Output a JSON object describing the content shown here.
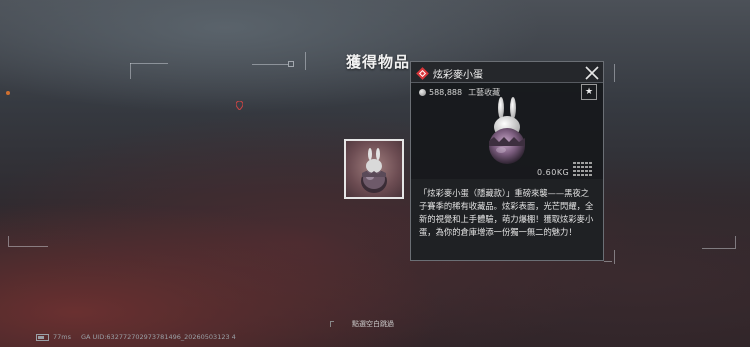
{
  "title": "獲得物品",
  "item": {
    "name": "炫彩麥小蛋",
    "price": "588,888",
    "category": "工藝收藏",
    "weight": "0.60KG",
    "description": "「炫彩麥小蛋（隱藏款）」重磅來襲——黑夜之子賽季的稀有收藏品。炫彩表面，光芒閃耀，全新的視覺和上手體驗，萌力爆棚！獲取炫彩麥小蛋，為你的倉庫增添一份獨一無二的魅力！"
  },
  "hint": "點選空白跳過",
  "status": {
    "latency": "77ms",
    "uid": "GA UID:632772702973781496_20260503123 4"
  },
  "icons": {
    "badge": "red-diamond-icon",
    "close": "close-icon",
    "star": "star-icon",
    "coin": "coin-icon",
    "grid": "size-grid-icon"
  },
  "colors": {
    "badge": "#d8363b",
    "accent": "#e6e6e6"
  }
}
